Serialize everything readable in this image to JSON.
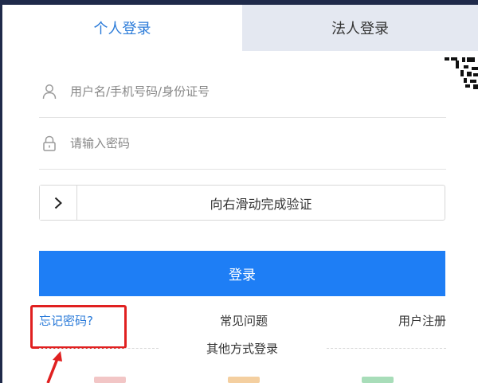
{
  "tabs": {
    "personal": "个人登录",
    "legal": "法人登录"
  },
  "username": {
    "placeholder": "用户名/手机号码/身份证号",
    "value": ""
  },
  "password": {
    "placeholder": "请输入密码",
    "value": ""
  },
  "slider": {
    "label": "向右滑动完成验证",
    "handle_icon": "chevron-right-icon",
    "progress": 0
  },
  "login_button": "登录",
  "links": {
    "forgot": "忘记密码?",
    "faq": "常见问题",
    "register": "用户注册"
  },
  "other_login": "其他方式登录",
  "colors": {
    "accent": "#1e7ef5",
    "link_blue": "#2b7bd9",
    "tab_inactive_bg": "#e4e8f1",
    "highlight": "#e02020"
  },
  "icons": [
    "user-icon",
    "lock-icon",
    "chevron-right-icon",
    "qr-code-icon"
  ]
}
